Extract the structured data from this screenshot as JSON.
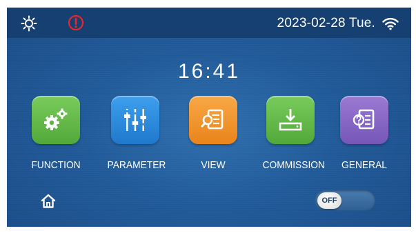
{
  "status_bar": {
    "brightness_icon": "sun-icon",
    "alert_icon": "exclamation-circle-icon",
    "alert_color": "#e8262d",
    "datetime": "2023-02-28 Tue.",
    "wifi_icon": "wifi-icon"
  },
  "clock": {
    "time": "16:41"
  },
  "menu": {
    "items": [
      {
        "label": "FUNCTION",
        "icon": "gears-icon",
        "color": "#67be4c"
      },
      {
        "label": "PARAMETER",
        "icon": "sliders-icon",
        "color": "#2f8fe0"
      },
      {
        "label": "VIEW",
        "icon": "view-doc-icon",
        "color": "#f2952d"
      },
      {
        "label": "COMMISSION",
        "icon": "download-icon",
        "color": "#67be4c"
      },
      {
        "label": "GENERAL",
        "icon": "help-doc-icon",
        "color": "#8a69c4"
      }
    ]
  },
  "footer": {
    "home_icon": "home-icon",
    "toggle": {
      "label": "OFF",
      "state": "off"
    }
  }
}
